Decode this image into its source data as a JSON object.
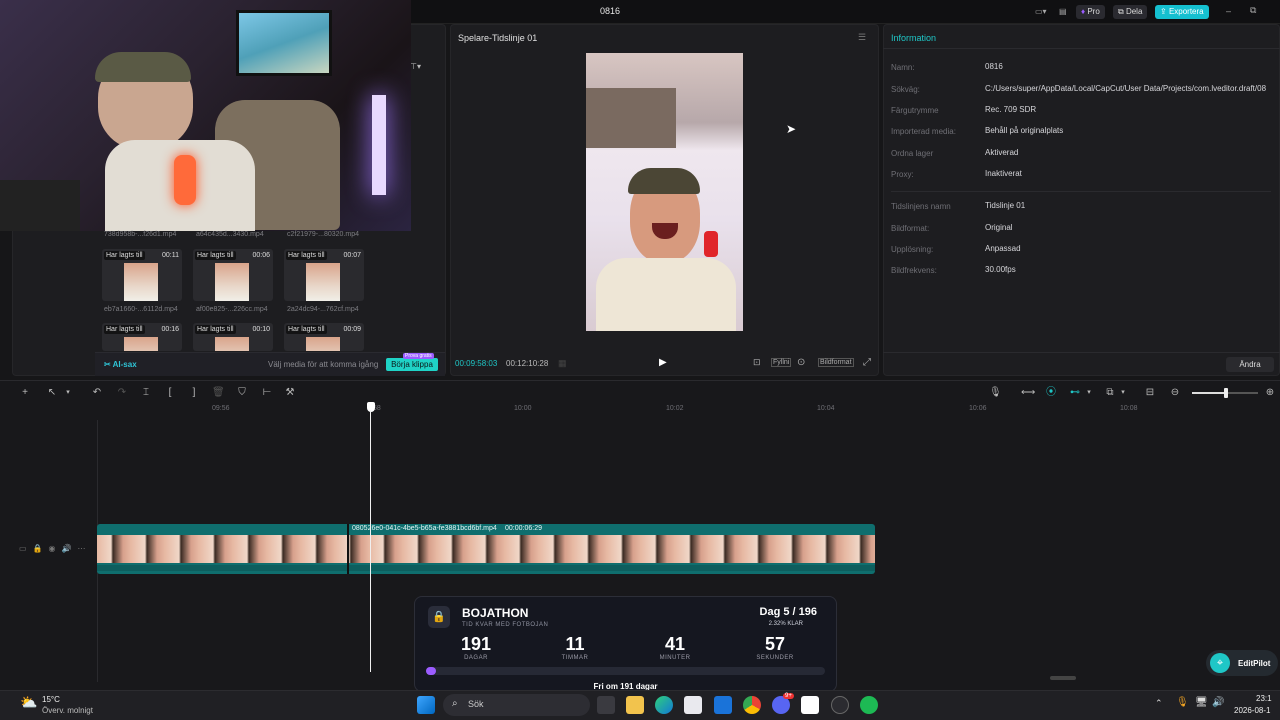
{
  "app": {
    "title": "0816",
    "pro_label": "Pro",
    "share_label": "Dela",
    "export_label": "Exportera"
  },
  "media": {
    "filenames_row0": [
      "738d958b-...f26d1.mp4",
      "a64c435d...3430.mp4",
      "c2f21979-...80320.mp4"
    ],
    "row1": [
      {
        "tag": "Har lagts till",
        "dur": "00:11",
        "name": "eb7a1660-...6112d.mp4"
      },
      {
        "tag": "Har lagts till",
        "dur": "00:06",
        "name": "af00e825-...226cc.mp4"
      },
      {
        "tag": "Har lagts till",
        "dur": "00:07",
        "name": "2a24dc94-...762cf.mp4"
      }
    ],
    "row2": [
      {
        "tag": "Har lagts till",
        "dur": "00:16"
      },
      {
        "tag": "Har lagts till",
        "dur": "00:10"
      },
      {
        "tag": "Har lagts till",
        "dur": "00:09"
      }
    ],
    "ai_label": "AI-sax",
    "hint": "Välj media för att komma igång",
    "start_button": "Börja klippa",
    "start_badge": "Prova gratis"
  },
  "player": {
    "title": "Spelare-Tidslinje 01",
    "current_time": "00:09:58:03",
    "total_time": "00:12:10:28",
    "fill_label": "Fyllni",
    "ratio_label": "Bildformat"
  },
  "info": {
    "title": "Information",
    "rows": [
      {
        "k": "Namn:",
        "v": "0816"
      },
      {
        "k": "Sökväg:",
        "v": "C:/Users/super/AppData/Local/CapCut/User Data/Projects/com.lveditor.draft/08"
      },
      {
        "k": "Färgutrymme",
        "v": "Rec. 709 SDR"
      },
      {
        "k": "Importerad media:",
        "v": "Behåll på originalplats"
      },
      {
        "k": "Ordna lager",
        "v": "Aktiverad"
      },
      {
        "k": "Proxy:",
        "v": "Inaktiverat"
      },
      {
        "k": "Tidslinjens namn",
        "v": "Tidslinje 01"
      },
      {
        "k": "Bildformat:",
        "v": "Original"
      },
      {
        "k": "Upplösning:",
        "v": "Anpassad"
      },
      {
        "k": "Bildfrekvens:",
        "v": "30.00fps"
      }
    ],
    "change_button": "Ändra"
  },
  "timeline": {
    "ticks": [
      "09:56",
      "58",
      "10:00",
      "10:02",
      "10:04",
      "10:06",
      "10:08"
    ],
    "clip_label": "080526e0-041c-4be5-b65a-fe3881bcd6bf.mp4",
    "clip_duration": "00:00:06:29"
  },
  "bojathon": {
    "title": "BOJATHON",
    "subtitle": "TID KVAR MED FOTBOJAN",
    "day": "Dag 5 / 196",
    "percent_text": "2.32% KLAR",
    "progress": 0.0232,
    "units": [
      {
        "num": "191",
        "label": "DAGAR"
      },
      {
        "num": "11",
        "label": "TIMMAR"
      },
      {
        "num": "41",
        "label": "MINUTER"
      },
      {
        "num": "57",
        "label": "SEKUNDER"
      }
    ],
    "footer": "Fri om 191 dagar"
  },
  "editpilot": {
    "label": "EditPilot"
  },
  "taskbar": {
    "temp": "15°C",
    "weather": "Överv. molnigt",
    "search_placeholder": "Sök",
    "time": "23:1",
    "date": "2026-08-1",
    "badge": "9+"
  },
  "colors": {
    "accent": "#1fc7c7",
    "export": "#15c0d0",
    "purple": "#9b5cff"
  }
}
